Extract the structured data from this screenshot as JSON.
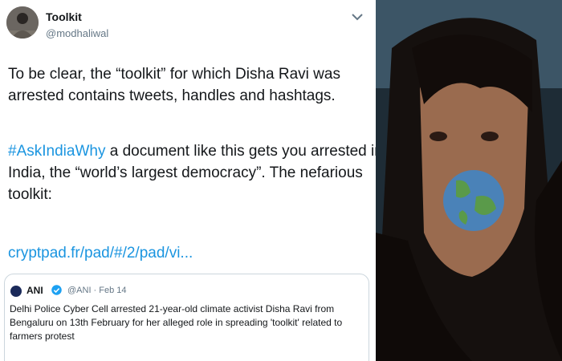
{
  "tweet": {
    "display_name": "Toolkit",
    "handle": "@modhaliwal",
    "line1": "To be clear, the “toolkit” for which Disha Ravi was",
    "line2": "arrested contains tweets, handles and hashtags.",
    "hashtag": "#AskIndiaWhy",
    "line3_rest": " a document like this gets you arrested in",
    "line4": "India, the “world’s largest democracy”. The nefarious",
    "line5": "toolkit:",
    "link": "cryptpad.fr/pad/#/2/pad/vi..."
  },
  "quote": {
    "name": "ANI",
    "meta": "@ANI · Feb 14",
    "text": "Delhi Police Cyber Cell arrested 21-year-old climate activist Disha Ravi from Bengaluru on 13th February for her alleged role in spreading 'toolkit' related to farmers protest"
  },
  "icons": {
    "menu": "more-menu-icon",
    "verified": "verified-badge-icon"
  },
  "colors": {
    "link": "#1b95e0",
    "text": "#14171a",
    "muted": "#657786",
    "border": "#ccd6dd"
  }
}
